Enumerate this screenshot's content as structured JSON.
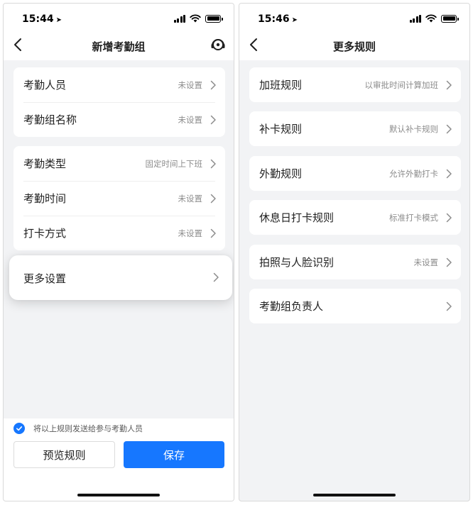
{
  "left": {
    "status": {
      "time": "15:44"
    },
    "nav": {
      "title": "新增考勤组"
    },
    "group1": [
      {
        "label": "考勤人员",
        "value": "未设置"
      },
      {
        "label": "考勤组名称",
        "value": "未设置"
      }
    ],
    "group2": [
      {
        "label": "考勤类型",
        "value": "固定时间上下班"
      },
      {
        "label": "考勤时间",
        "value": "未设置"
      },
      {
        "label": "打卡方式",
        "value": "未设置"
      }
    ],
    "more_settings": {
      "label": "更多设置"
    },
    "bottom": {
      "checkbox_label": "将以上规则发送给参与考勤人员",
      "checkbox_checked": true,
      "preview_button": "预览规则",
      "save_button": "保存"
    }
  },
  "right": {
    "status": {
      "time": "15:46"
    },
    "nav": {
      "title": "更多规则"
    },
    "rules": [
      {
        "label": "加班规则",
        "value": "以审批时间计算加班"
      },
      {
        "label": "补卡规则",
        "value": "默认补卡规则"
      },
      {
        "label": "外勤规则",
        "value": "允许外勤打卡"
      },
      {
        "label": "休息日打卡规则",
        "value": "标准打卡模式"
      },
      {
        "label": "拍照与人脸识别",
        "value": "未设置"
      },
      {
        "label": "考勤组负责人",
        "value": ""
      }
    ]
  },
  "colors": {
    "accent": "#1677ff",
    "background": "#f2f3f5",
    "card": "#ffffff",
    "secondary_text": "#8c8c8c"
  },
  "icons": [
    "location-arrow-icon",
    "signal-icon",
    "wifi-icon",
    "battery-icon",
    "back-icon",
    "headset-icon",
    "chevron-right-icon",
    "check-icon"
  ]
}
